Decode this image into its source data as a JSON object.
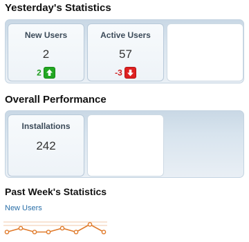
{
  "yesterday": {
    "title": "Yesterday's Statistics",
    "cards": [
      {
        "label": "New Users",
        "value": "2",
        "delta": "2",
        "direction": "up"
      },
      {
        "label": "Active Users",
        "value": "57",
        "delta": "-3",
        "direction": "down"
      }
    ]
  },
  "overall": {
    "title": "Overall Performance",
    "cards": [
      {
        "label": "Installations",
        "value": "242"
      }
    ]
  },
  "past_week": {
    "title": "Past Week's Statistics",
    "metric_link": "New Users"
  },
  "colors": {
    "up": "#22a722",
    "down": "#de2121",
    "link": "#2a6fa8",
    "sparkline": "#e07a2a"
  },
  "icons": {
    "up": "arrow-up-icon",
    "down": "arrow-down-icon"
  },
  "chart_data": {
    "type": "line",
    "series": [
      {
        "values": [
          1,
          2,
          1,
          1,
          2,
          1,
          3,
          1
        ]
      }
    ],
    "ylim": [
      0,
      4
    ]
  }
}
